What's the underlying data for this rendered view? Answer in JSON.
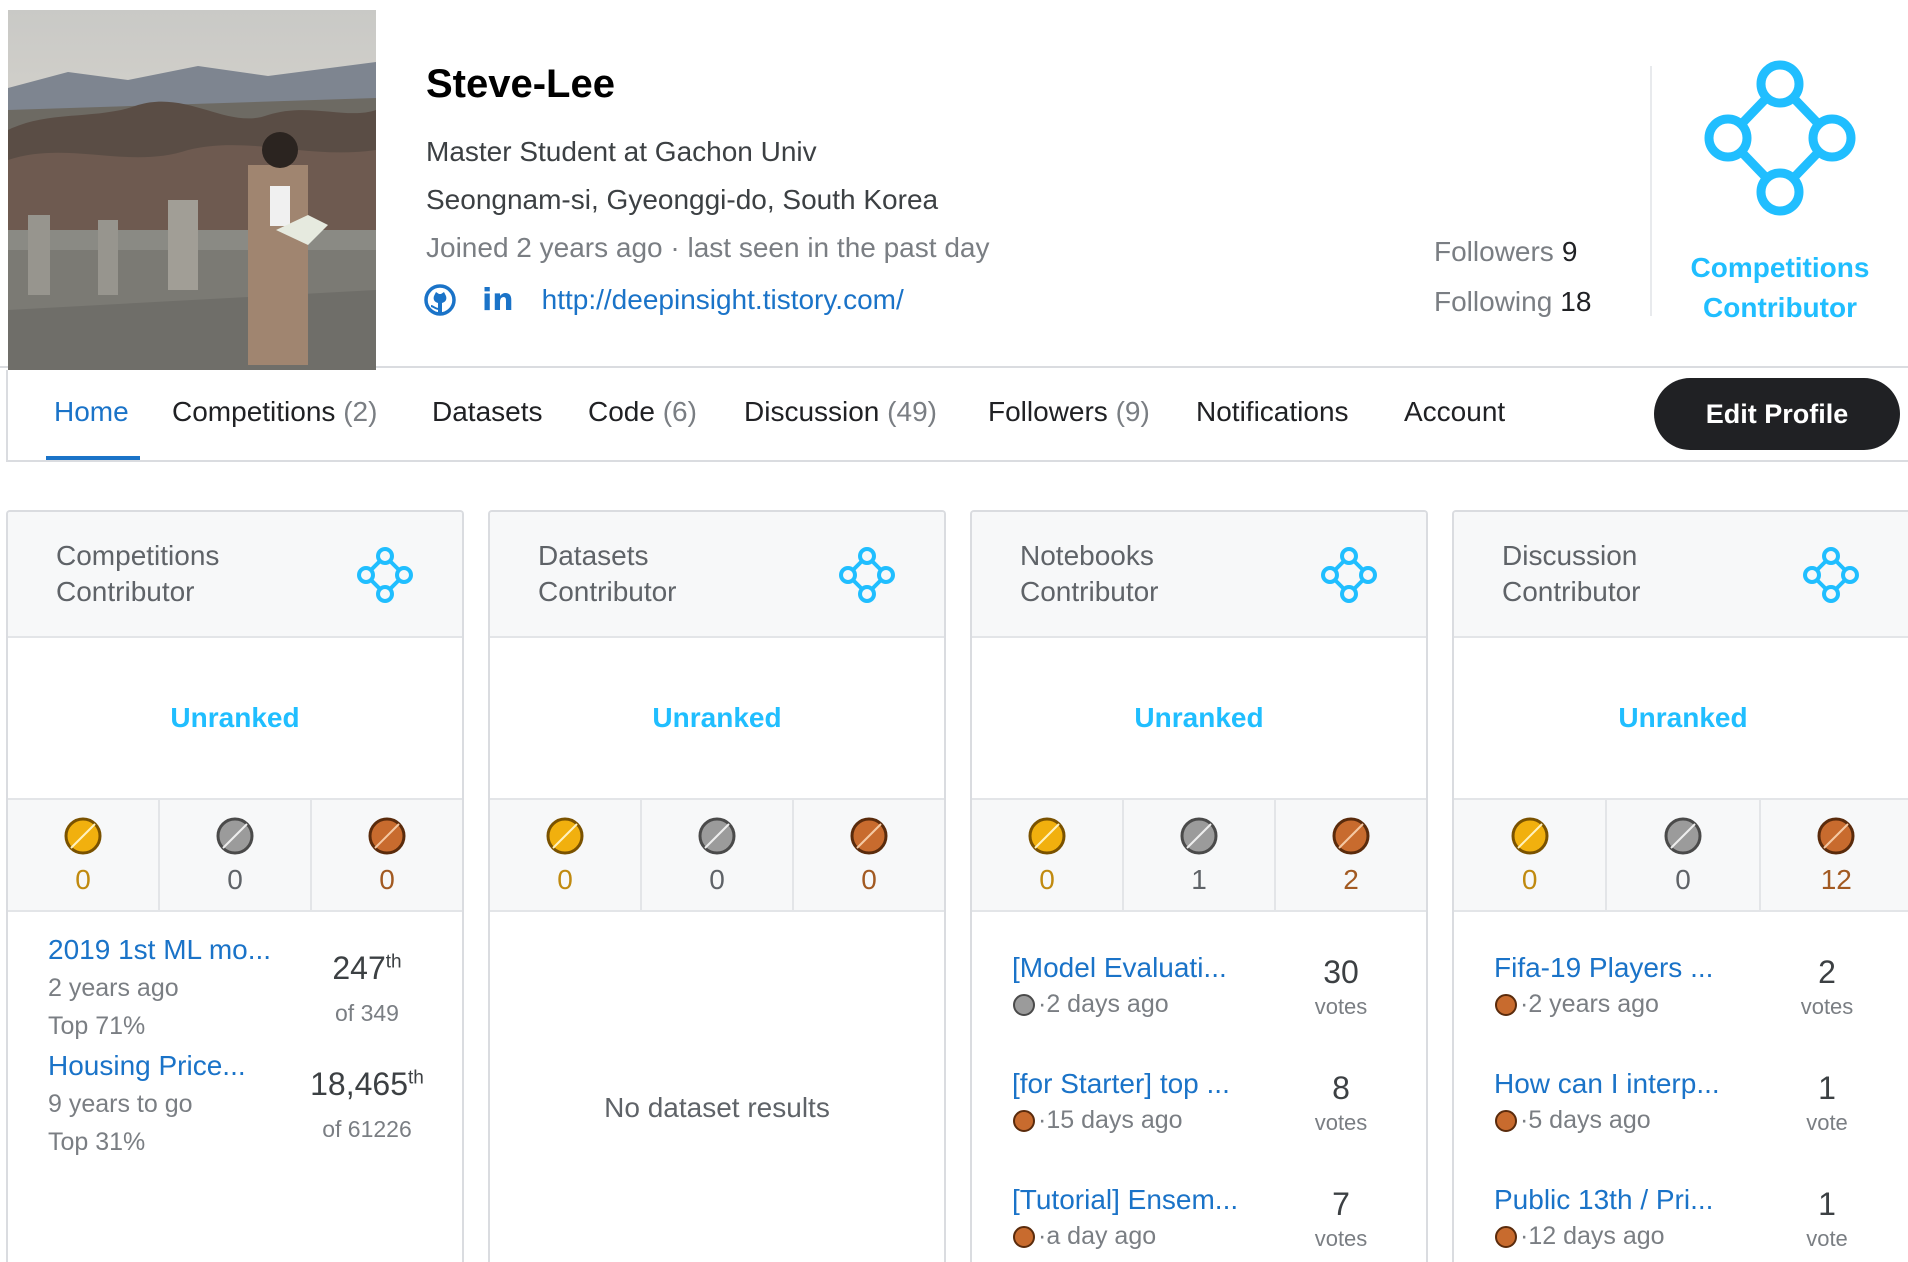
{
  "profile": {
    "name": "Steve-Lee",
    "occupation": "Master Student at Gachon Univ",
    "location": "Seongnam-si, Gyeonggi-do, South Korea",
    "joined": "Joined 2 years ago · last seen in the past day",
    "github_icon": "github-icon",
    "linkedin_label": "in",
    "website": "http://deepinsight.tistory.com/",
    "followers_label": "Followers",
    "followers_count": "9",
    "following_label": "Following",
    "following_count": "18",
    "tier_icon": "tier-diamond-icon",
    "tier_line1": "Competitions",
    "tier_line2": "Contributor"
  },
  "nav": {
    "tabs": [
      {
        "label": "Home",
        "count": ""
      },
      {
        "label": "Competitions",
        "count": "(2)"
      },
      {
        "label": "Datasets",
        "count": ""
      },
      {
        "label": "Code",
        "count": "(6)"
      },
      {
        "label": "Discussion",
        "count": "(49)"
      },
      {
        "label": "Followers",
        "count": "(9)"
      },
      {
        "label": "Notifications",
        "count": ""
      },
      {
        "label": "Account",
        "count": ""
      }
    ],
    "active_tab": "Home",
    "edit_button": "Edit Profile"
  },
  "colors": {
    "accent_blue": "#20beff",
    "link_blue": "#1a73c8",
    "gold": "#f1b00e",
    "silver": "#9b9b9b",
    "bronze": "#c86b2e"
  },
  "cards": [
    {
      "title_line1": "Competitions",
      "title_line2": "Contributor",
      "rank": "Unranked",
      "medals": {
        "gold": "0",
        "silver": "0",
        "bronze": "0"
      },
      "items": [
        {
          "title": "2019 1st ML mo...",
          "when": "2 years ago",
          "top": "Top 71%",
          "place": "247",
          "suffix": "th",
          "of": "of 349"
        },
        {
          "title": "Housing Price...",
          "when": "9 years to go",
          "top": "Top 31%",
          "place": "18,465",
          "suffix": "th",
          "of": "of 61226"
        }
      ]
    },
    {
      "title_line1": "Datasets",
      "title_line2": "Contributor",
      "rank": "Unranked",
      "medals": {
        "gold": "0",
        "silver": "0",
        "bronze": "0"
      },
      "empty": "No dataset results"
    },
    {
      "title_line1": "Notebooks",
      "title_line2": "Contributor",
      "rank": "Unranked",
      "medals": {
        "gold": "0",
        "silver": "1",
        "bronze": "2"
      },
      "items": [
        {
          "title": "[Model Evaluati...",
          "medal": "silver",
          "when": "·2 days ago",
          "votes": "30",
          "votes_label": "votes"
        },
        {
          "title": "[for Starter] top ...",
          "medal": "bronze",
          "when": "·15 days ago",
          "votes": "8",
          "votes_label": "votes"
        },
        {
          "title": "[Tutorial] Ensem...",
          "medal": "bronze",
          "when": "·a day ago",
          "votes": "7",
          "votes_label": "votes"
        }
      ]
    },
    {
      "title_line1": "Discussion",
      "title_line2": "Contributor",
      "rank": "Unranked",
      "medals": {
        "gold": "0",
        "silver": "0",
        "bronze": "12"
      },
      "items": [
        {
          "title": "Fifa-19 Players ...",
          "medal": "bronze",
          "when": "·2 years ago",
          "votes": "2",
          "votes_label": "votes"
        },
        {
          "title": "How can I interp...",
          "medal": "bronze",
          "when": "·5 days ago",
          "votes": "1",
          "votes_label": "vote"
        },
        {
          "title": "Public 13th / Pri...",
          "medal": "bronze",
          "when": "·12 days ago",
          "votes": "1",
          "votes_label": "vote"
        }
      ]
    }
  ]
}
